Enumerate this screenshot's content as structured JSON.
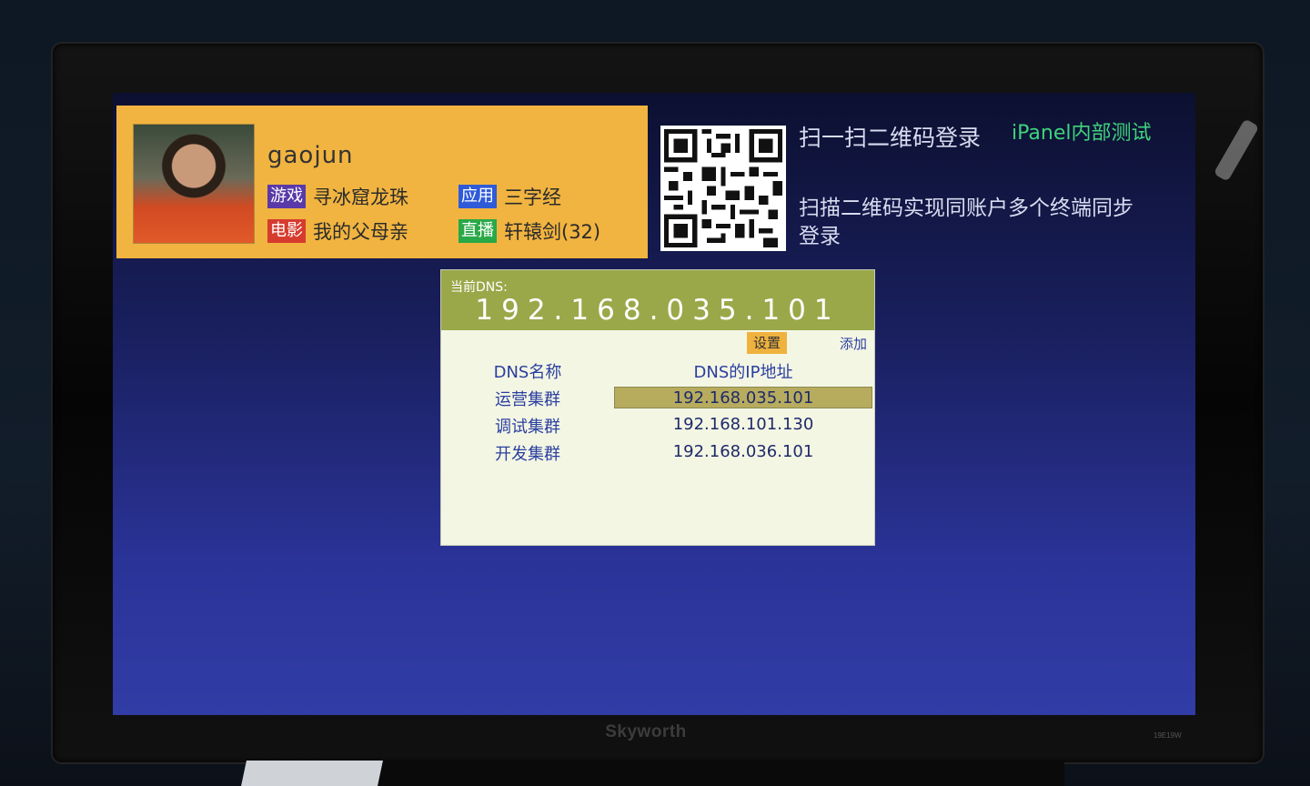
{
  "tv": {
    "brand": "Skyworth",
    "model": "19E19W"
  },
  "user": {
    "name": "gaojun",
    "recommendations": [
      {
        "tag": "游戏",
        "tag_color": "#5a3aa8",
        "title": "寻冰窟龙珠"
      },
      {
        "tag": "应用",
        "tag_color": "#2f5bd8",
        "title": "三字经"
      },
      {
        "tag": "电影",
        "tag_color": "#d63c2e",
        "title": "我的父母亲"
      },
      {
        "tag": "直播",
        "tag_color": "#29a847",
        "title": "轩辕剑(32)"
      }
    ]
  },
  "qr": {
    "title": "扫一扫二维码登录",
    "brand": "iPanel内部测试",
    "description": "扫描二维码实现同账户多个终端同步登录"
  },
  "dns": {
    "current_label": "当前DNS:",
    "current_value": "192.168.035.101",
    "set_label": "设置",
    "add_label": "添加",
    "col_name": "DNS名称",
    "col_ip": "DNS的IP地址",
    "entries": [
      {
        "name": "运营集群",
        "ip": "192.168.035.101"
      },
      {
        "name": "调试集群",
        "ip": "192.168.101.130"
      },
      {
        "name": "开发集群",
        "ip": "192.168.036.101"
      }
    ]
  },
  "colors": {
    "user_panel": "#f1b440",
    "dns_header": "#9aa84a",
    "selected_row": "#b7ab5e",
    "accent_green": "#3fd37c"
  }
}
